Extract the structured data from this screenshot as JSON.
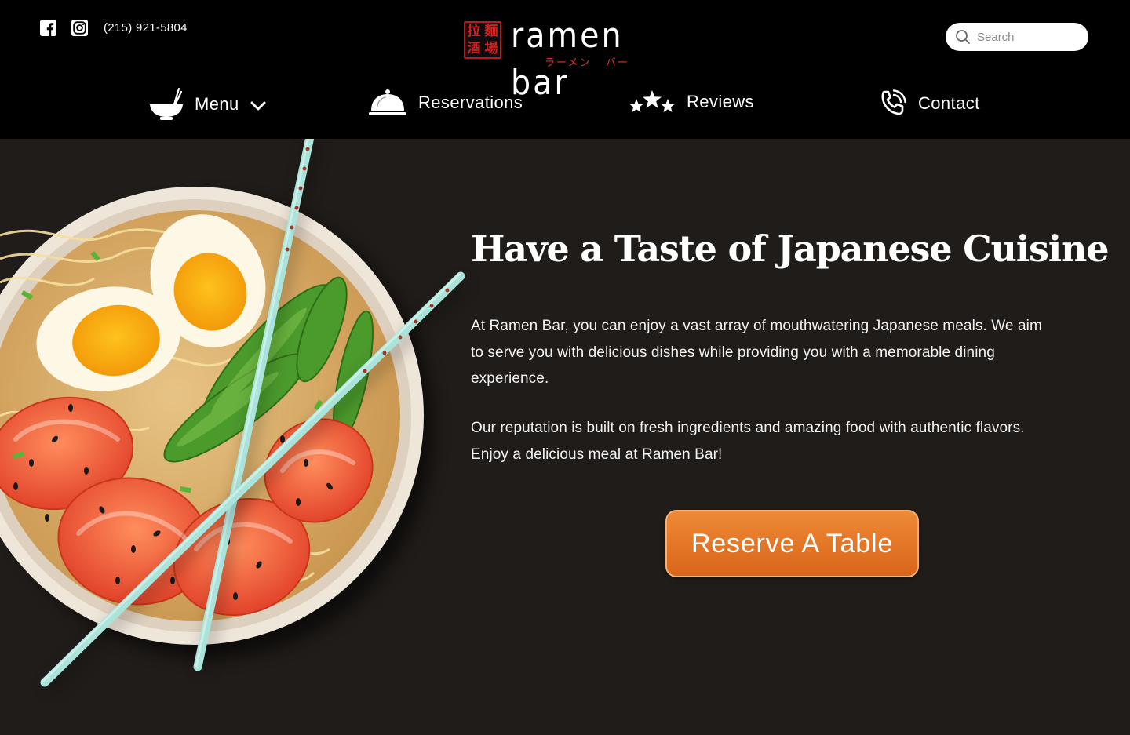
{
  "header": {
    "phone": "(215) 921-5804",
    "logo": {
      "seal_chars": [
        "拉",
        "麵",
        "酒",
        "場"
      ],
      "wordmark": "ramen bar",
      "kana": "ラーメン   バー"
    },
    "search": {
      "placeholder": "Search"
    }
  },
  "nav": {
    "items": [
      {
        "label": "Menu",
        "icon": "ramen-bowl-icon",
        "has_dropdown": true
      },
      {
        "label": "Reservations",
        "icon": "cloche-icon"
      },
      {
        "label": "Reviews",
        "icon": "stars-icon"
      },
      {
        "label": "Contact",
        "icon": "phone-icon"
      }
    ]
  },
  "hero": {
    "title": "Have a Taste of Japanese Cuisine",
    "paragraphs": [
      "At Ramen Bar, you can enjoy a vast array of mouthwatering Japanese meals. We aim to serve you with delicious dishes while providing you with a memorable dining experience.",
      "Our reputation is built on fresh ingredients and amazing food with authentic flavors. Enjoy a delicious meal at Ramen Bar!"
    ],
    "cta_label": "Reserve A Table"
  },
  "colors": {
    "header_bg": "#000000",
    "page_bg": "#201c19",
    "accent_orange": "#e4752a",
    "logo_red": "#d02424",
    "chopstick_mint": "#a9e3da"
  }
}
